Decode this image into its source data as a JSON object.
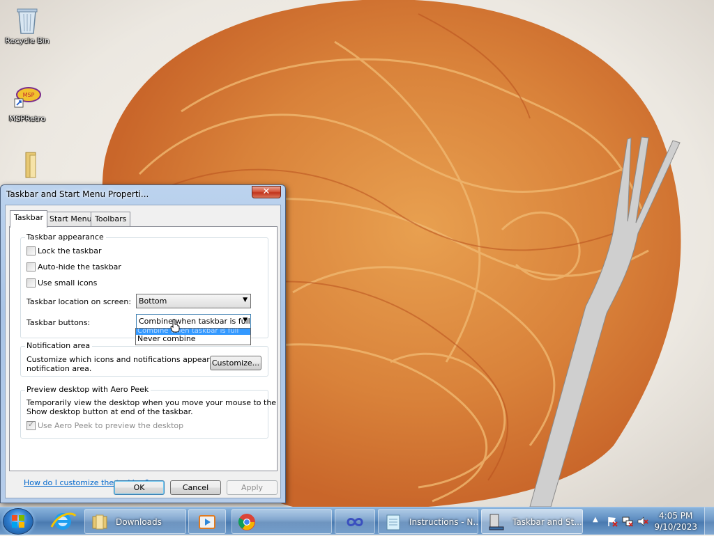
{
  "desktop": {
    "icons": [
      {
        "label": "Recycle Bin",
        "icon": "recycle-bin-icon"
      },
      {
        "label": "MSPRetro",
        "icon": "msp-retro-shortcut-icon"
      },
      {
        "label": "",
        "icon": "folder-icon"
      }
    ],
    "wallpaper": "spaghetti-with-tomato-sauce-and-fork"
  },
  "dialog": {
    "title": "Taskbar and Start Menu Properti...",
    "close_label": "✕",
    "tabs": [
      {
        "label": "Taskbar",
        "active": true
      },
      {
        "label": "Start Menu",
        "active": false
      },
      {
        "label": "Toolbars",
        "active": false
      }
    ],
    "appearance": {
      "title": "Taskbar appearance",
      "lock": {
        "label": "Lock the taskbar",
        "checked": false
      },
      "autohide": {
        "label": "Auto-hide the taskbar",
        "checked": false
      },
      "small_icons": {
        "label": "Use small icons",
        "checked": false
      },
      "location": {
        "label": "Taskbar location on screen:",
        "value": "Bottom"
      },
      "buttons": {
        "label": "Taskbar buttons:",
        "value": "Combine when taskbar is full",
        "options": [
          "Combine when taskbar is full",
          "Never combine"
        ],
        "highlighted": "Combine when taskbar is full"
      }
    },
    "notification": {
      "title": "Notification area",
      "text_line1": "Customize which icons and notifications appear in the",
      "text_line2": "notification area.",
      "customize_label": "Customize..."
    },
    "aero_peek": {
      "title": "Preview desktop with Aero Peek",
      "text_line1": "Temporarily view the desktop when you move your mouse to the",
      "text_line2": "Show desktop button at end of the taskbar.",
      "checkbox_label": "Use Aero Peek to preview the desktop",
      "checked": true,
      "disabled": true
    },
    "help_link": "How do I customize the taskbar?",
    "ok_label": "OK",
    "cancel_label": "Cancel",
    "apply_label": "Apply"
  },
  "taskbar": {
    "start_icon": "windows-start-orb-icon",
    "pinned": [
      {
        "icon": "internet-explorer-icon"
      }
    ],
    "buttons": [
      {
        "label": "Downloads",
        "icon": "folder-icon",
        "active": false
      },
      {
        "label": "",
        "icon": "media-player-icon",
        "active": false
      },
      {
        "label": "",
        "icon": "chrome-icon",
        "active": false
      },
      {
        "label": "",
        "icon": "app-infinity-icon",
        "active": false
      },
      {
        "label": "Instructions - N...",
        "icon": "notepad-icon",
        "active": false
      },
      {
        "label": "Taskbar and St...",
        "icon": "taskbar-properties-icon",
        "active": true
      }
    ],
    "tray": {
      "time": "4:05 PM",
      "date": "9/10/2023"
    }
  },
  "colors": {
    "link": "#0066cc",
    "selection": "#3399ff",
    "taskbar": "#5d8cc0"
  }
}
